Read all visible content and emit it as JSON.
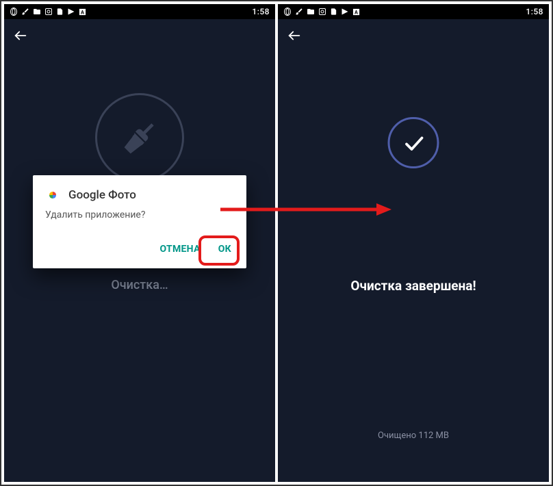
{
  "status": {
    "time": "1:58"
  },
  "left": {
    "dialog": {
      "app_name": "Google Фото",
      "message": "Удалить приложение?",
      "cancel": "ОТМЕНА",
      "ok": "ОК"
    },
    "cleaning_label": "Очистка…"
  },
  "right": {
    "done_label": "Очистка завершена!",
    "cleaned_amount": "Очищено 112 MB"
  }
}
